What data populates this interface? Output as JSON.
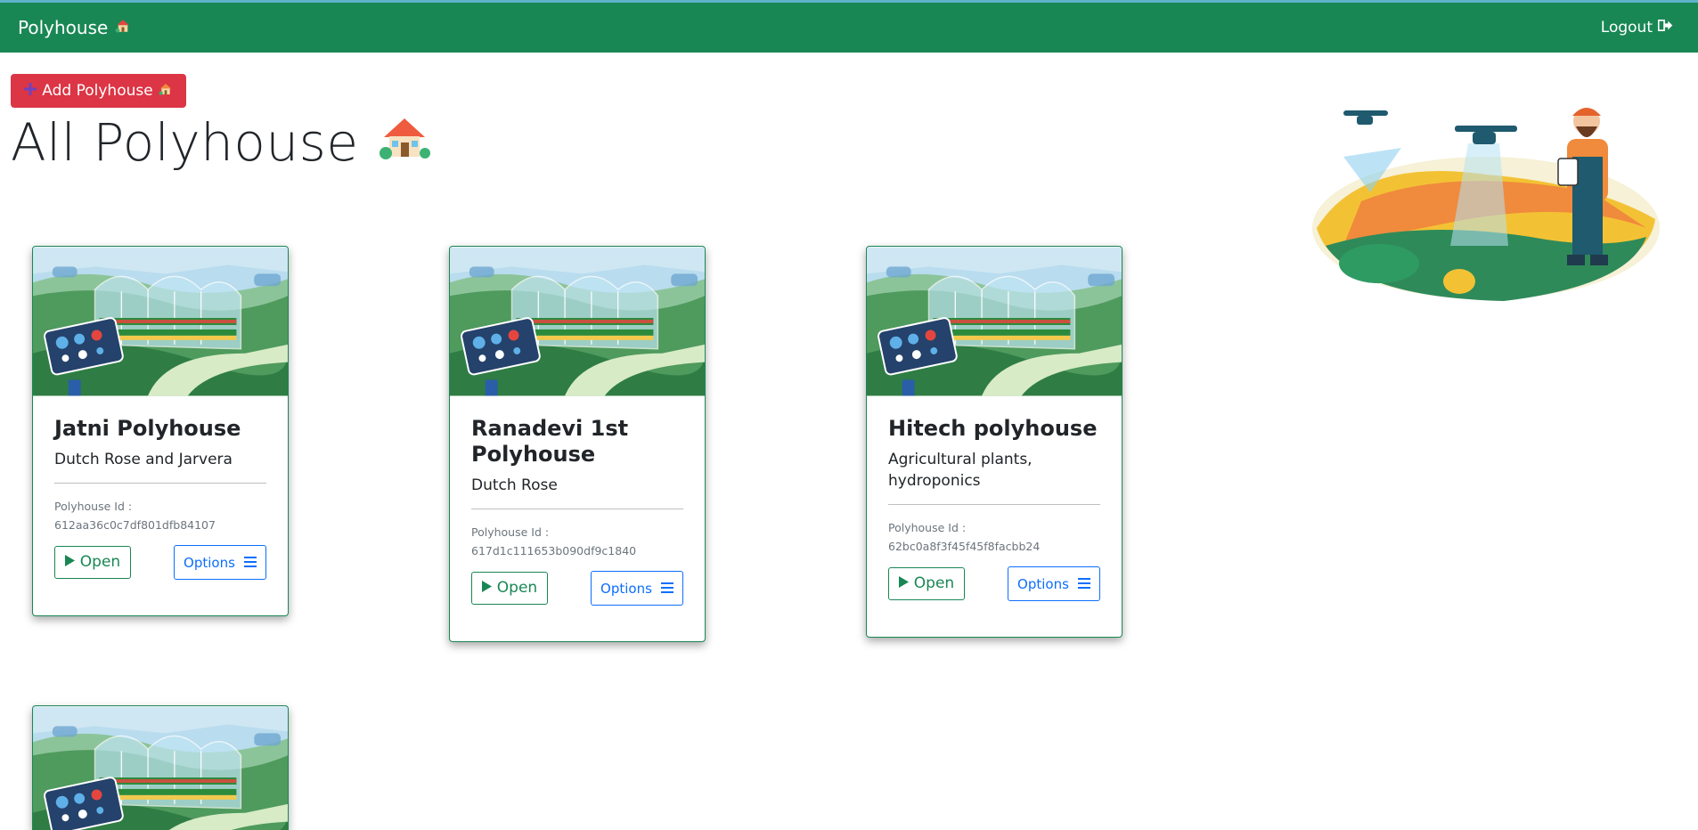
{
  "navbar": {
    "brand": "Polyhouse",
    "logout_label": "Logout"
  },
  "actions": {
    "add_label": "Add Polyhouse"
  },
  "page": {
    "title": "All Polyhouse"
  },
  "id_label": "Polyhouse Id :",
  "open_label": "Open",
  "options_label": "Options",
  "cards": [
    {
      "title": "Jatni Polyhouse",
      "subtitle": "Dutch Rose and Jarvera",
      "id": "612aa36c0c7df801dfb84107"
    },
    {
      "title": "Ranadevi 1st Polyhouse",
      "subtitle": "Dutch Rose",
      "id": "617d1c111653b090df9c1840"
    },
    {
      "title": "Hitech polyhouse",
      "subtitle": "Agricultural plants, hydroponics",
      "id": "62bc0a8f3f45f45f8facbb24"
    }
  ],
  "colors": {
    "navbar": "#198754",
    "add_button": "#dc3545",
    "open_button": "#198754",
    "options_button": "#0d6efd"
  }
}
